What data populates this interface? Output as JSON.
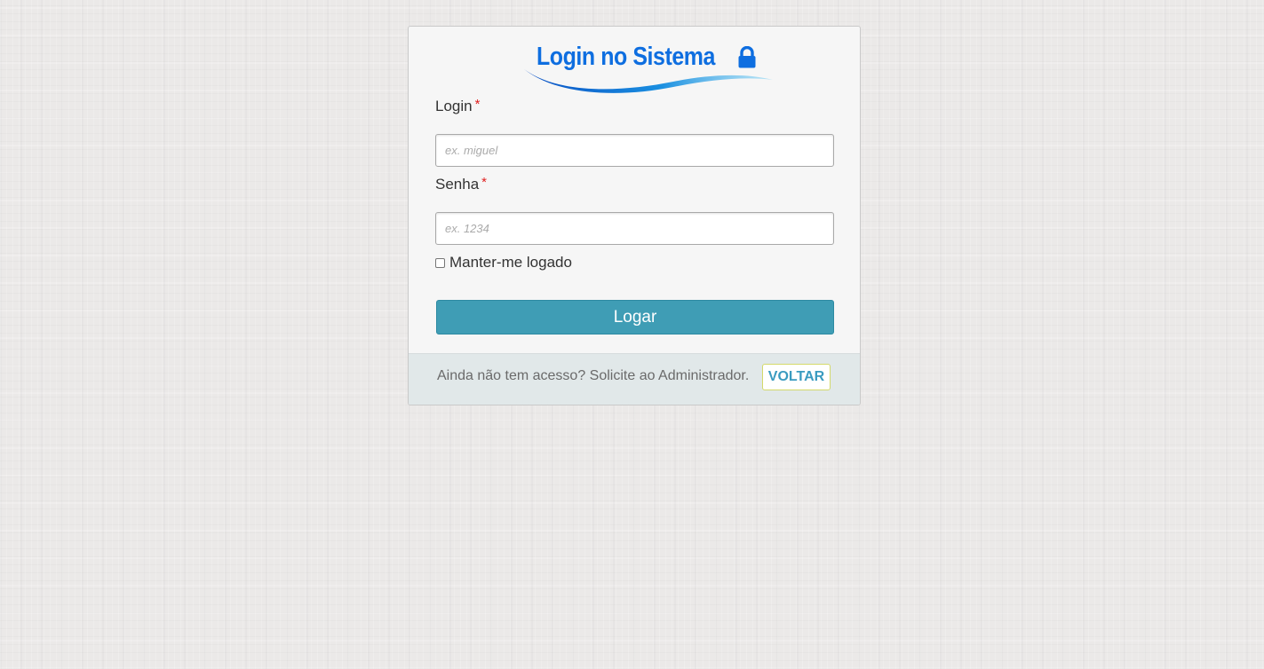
{
  "logo": {
    "title": "Login no Sistema",
    "icon": "lock-icon",
    "color": "#0e6ee0"
  },
  "form": {
    "login_label": "Login",
    "login_required": "*",
    "login_placeholder": "ex. miguel",
    "login_value": "",
    "password_label": "Senha",
    "password_required": "*",
    "password_placeholder": "ex. 1234",
    "password_value": "",
    "remember_label": "Manter-me logado",
    "remember_checked": false,
    "submit_label": "Logar",
    "submit_color": "#3f9db5"
  },
  "footer": {
    "text": "Ainda não tem acesso? Solicite ao Administrador.",
    "back_label": "VOLTAR"
  }
}
